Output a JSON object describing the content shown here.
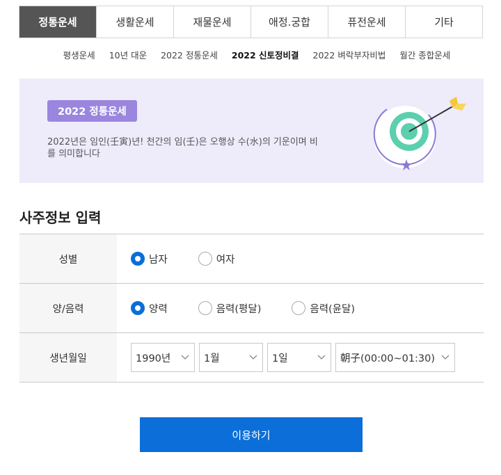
{
  "tabs": [
    {
      "label": "정통운세",
      "active": true
    },
    {
      "label": "생활운세",
      "active": false
    },
    {
      "label": "재물운세",
      "active": false
    },
    {
      "label": "애정.궁합",
      "active": false
    },
    {
      "label": "퓨전운세",
      "active": false
    },
    {
      "label": "기타",
      "active": false
    }
  ],
  "subnav": [
    {
      "label": "평생운세",
      "active": false
    },
    {
      "label": "10년 대운",
      "active": false
    },
    {
      "label": "2022 정통운세",
      "active": false
    },
    {
      "label": "2022 신토정비결",
      "active": true
    },
    {
      "label": "2022 벼락부자비법",
      "active": false
    },
    {
      "label": "월간 종합운세",
      "active": false
    }
  ],
  "banner": {
    "badge": "2022 정통운세",
    "description": "2022년은 임인(壬寅)년! 천간의 임(壬)은 오행상 수(水)의 기운이며 비를 의미합니다",
    "icon": "target-arrow-icon"
  },
  "section_title": "사주정보 입력",
  "form": {
    "gender": {
      "label": "성별",
      "options": [
        {
          "label": "남자",
          "checked": true
        },
        {
          "label": "여자",
          "checked": false
        }
      ]
    },
    "calendar": {
      "label": "양/음력",
      "options": [
        {
          "label": "양력",
          "checked": true
        },
        {
          "label": "음력(평달)",
          "checked": false
        },
        {
          "label": "음력(윤달)",
          "checked": false
        }
      ]
    },
    "birth": {
      "label": "생년월일",
      "year": "1990년",
      "month": "1월",
      "day": "1일",
      "hour": "朝子(00:00~01:30)"
    }
  },
  "submit_label": "이용하기",
  "colors": {
    "primary": "#0c6ed8",
    "badge": "#9a86de",
    "banner_bg": "#eeebfb",
    "active_tab": "#555555"
  }
}
